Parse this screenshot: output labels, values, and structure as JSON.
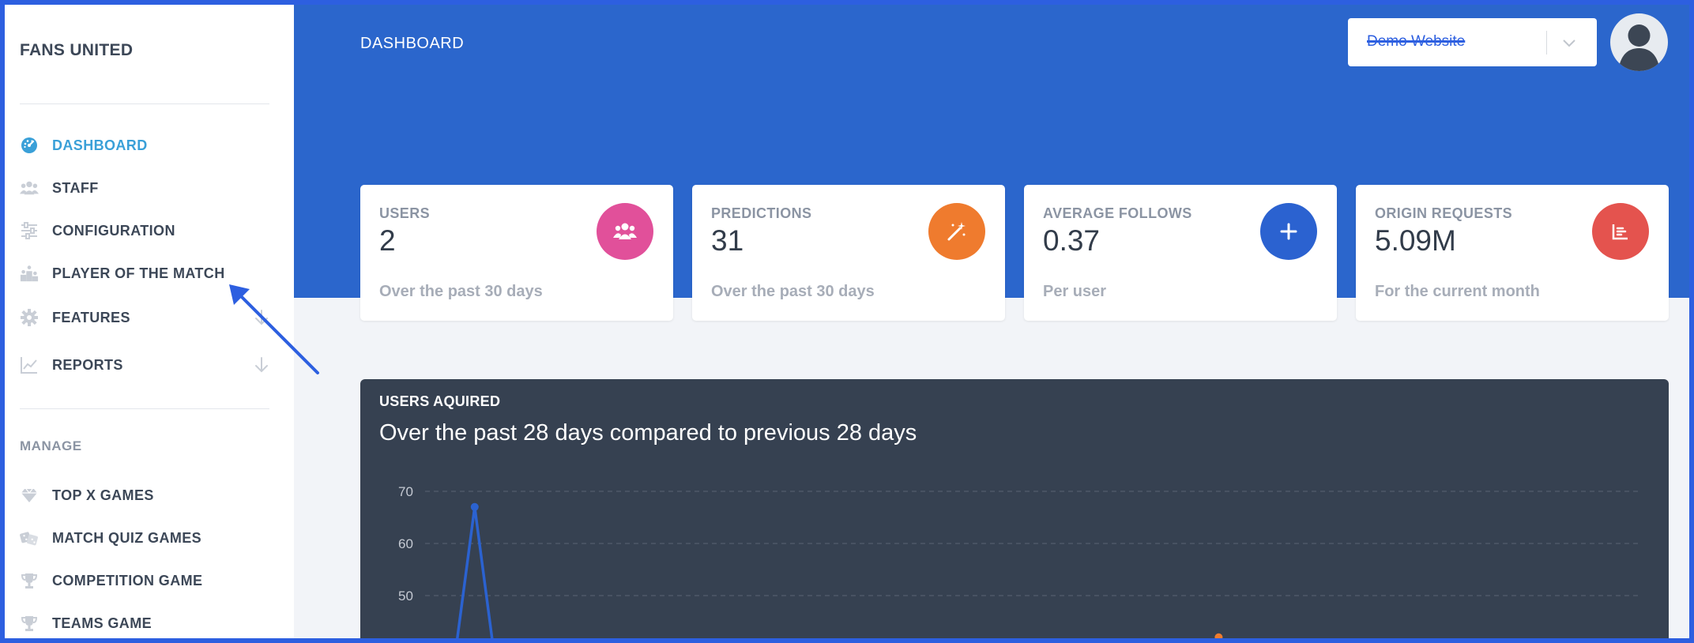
{
  "brand": "FANS UNITED",
  "nav": [
    {
      "label": "DASHBOARD",
      "icon": "gauge-icon",
      "active": true,
      "expandable": false
    },
    {
      "label": "STAFF",
      "icon": "users-icon",
      "active": false,
      "expandable": false
    },
    {
      "label": "CONFIGURATION",
      "icon": "sliders-icon",
      "active": false,
      "expandable": false
    },
    {
      "label": "PLAYER OF THE MATCH",
      "icon": "podium-icon",
      "active": false,
      "expandable": false
    },
    {
      "label": "FEATURES",
      "icon": "gear-icon",
      "active": false,
      "expandable": true
    },
    {
      "label": "REPORTS",
      "icon": "line-chart-icon",
      "active": false,
      "expandable": true
    }
  ],
  "manage": {
    "title": "MANAGE",
    "items": [
      {
        "label": "TOP X GAMES",
        "icon": "gem-icon"
      },
      {
        "label": "MATCH QUIZ GAMES",
        "icon": "dice-icon"
      },
      {
        "label": "COMPETITION GAME",
        "icon": "trophy-icon"
      },
      {
        "label": "TEAMS GAME",
        "icon": "trophy-icon"
      }
    ]
  },
  "header": {
    "title": "DASHBOARD",
    "site_selector": "Demo Website"
  },
  "cards": [
    {
      "title": "USERS",
      "value": "2",
      "sub": "Over the past 30 days",
      "color": "#e1509a",
      "icon": "users-icon"
    },
    {
      "title": "PREDICTIONS",
      "value": "31",
      "sub": "Over the past 30 days",
      "color": "#ef7b2e",
      "icon": "magic-wand-icon"
    },
    {
      "title": "AVERAGE FOLLOWS",
      "value": "0.37",
      "sub": "Per user",
      "color": "#2b62d0",
      "icon": "plus-icon"
    },
    {
      "title": "ORIGIN REQUESTS",
      "value": "5.09M",
      "sub": "For the current month",
      "color": "#e4534e",
      "icon": "bar-chart-icon"
    }
  ],
  "chart": {
    "title": "USERS AQUIRED",
    "subtitle": "Over the past 28 days compared to previous 28 days"
  },
  "chart_data": {
    "type": "line",
    "title": "USERS AQUIRED",
    "subtitle": "Over the past 28 days compared to previous 28 days",
    "y_ticks": [
      70,
      60,
      50
    ],
    "ylim_visible": [
      45,
      70
    ],
    "grid": true,
    "series": [
      {
        "color": "#2b62d0",
        "points": [
          [
            0.4,
            40
          ],
          [
            1,
            67
          ],
          [
            1.6,
            40
          ]
        ]
      },
      {
        "color": "#ef7b2e",
        "points": [
          [
            25,
            42
          ]
        ]
      }
    ],
    "xlim": [
      -0.6,
      38.6
    ]
  }
}
